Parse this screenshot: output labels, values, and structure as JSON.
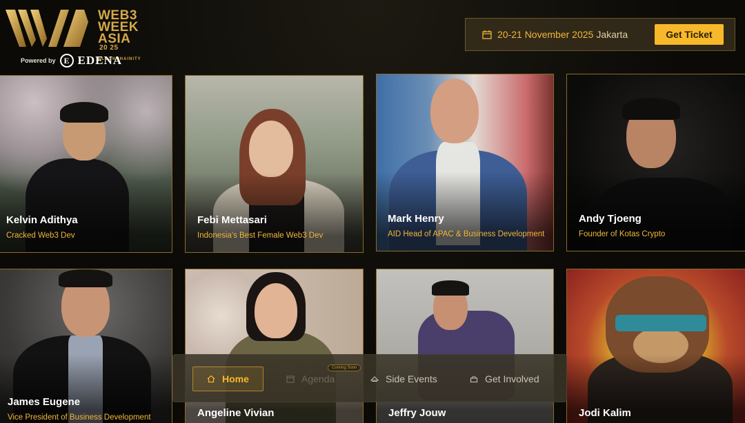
{
  "brand": {
    "logo_line1": "WEB3",
    "logo_line2": "WEEK",
    "logo_line3": "ASIA",
    "year": "20 25",
    "tagline": "BLOCKCHAINITY",
    "powered_by": "Powered by",
    "partner": "EDENA",
    "accent": "#f7b92a",
    "gold": "#d4a94a"
  },
  "event": {
    "date": "20-21 November 2025",
    "city": "Jakarta",
    "cta": "Get Ticket"
  },
  "speakers": [
    {
      "name": "Kelvin Adithya",
      "role": "Cracked Web3 Dev"
    },
    {
      "name": "Febi Mettasari",
      "role": "Indonesia's Best Female Web3 Dev"
    },
    {
      "name": "Mark Henry",
      "role": "AID Head of APAC & Business Development"
    },
    {
      "name": "Andy Tjoeng",
      "role": "Founder of Kotas Crypto"
    },
    {
      "name": "James Eugene",
      "role": "Vice President of Business Development"
    },
    {
      "name": "Angeline Vivian",
      "role": ""
    },
    {
      "name": "Jeffry Jouw",
      "role": ""
    },
    {
      "name": "Jodi Kalim",
      "role": ""
    }
  ],
  "nav": {
    "home": "Home",
    "agenda": "Agenda",
    "agenda_badge": "Coming Soon",
    "side_events": "Side Events",
    "get_involved": "Get Involved"
  }
}
